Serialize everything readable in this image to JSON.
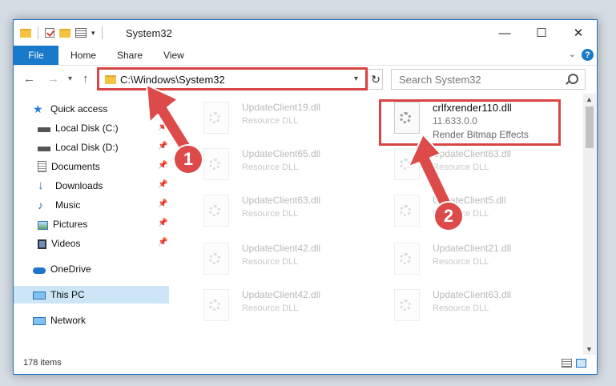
{
  "window": {
    "title": "System32",
    "minimize": "—",
    "maximize": "☐",
    "close": "✕"
  },
  "ribbon": {
    "tabs": [
      {
        "label": "File"
      },
      {
        "label": "Home"
      },
      {
        "label": "Share"
      },
      {
        "label": "View"
      }
    ],
    "help": "?"
  },
  "address": {
    "path": "C:\\Windows\\System32",
    "search_placeholder": "Search System32"
  },
  "sidebar": {
    "items": [
      {
        "label": "Quick access",
        "icon": "star-icon",
        "pinned": false
      },
      {
        "label": "Local Disk (C:)",
        "icon": "drive-icon",
        "pinned": true
      },
      {
        "label": "Local Disk (D:)",
        "icon": "drive-icon",
        "pinned": true
      },
      {
        "label": "Documents",
        "icon": "documents-icon",
        "pinned": true
      },
      {
        "label": "Downloads",
        "icon": "download-icon",
        "pinned": true
      },
      {
        "label": "Music",
        "icon": "music-icon",
        "pinned": true
      },
      {
        "label": "Pictures",
        "icon": "pictures-icon",
        "pinned": true
      },
      {
        "label": "Videos",
        "icon": "videos-icon",
        "pinned": true
      },
      {
        "label": "OneDrive",
        "icon": "cloud-icon",
        "pinned": false
      },
      {
        "label": "This PC",
        "icon": "computer-icon",
        "pinned": false,
        "selected": true
      },
      {
        "label": "Network",
        "icon": "network-icon",
        "pinned": false
      }
    ]
  },
  "files": {
    "left": [
      {
        "name": "UpdateClient19.dll",
        "type": "Resource DLL"
      },
      {
        "name": "UpdateClient65.dll",
        "type": "Resource DLL"
      },
      {
        "name": "UpdateClient63.dll",
        "type": "Resource DLL"
      },
      {
        "name": "UpdateClient42.dll",
        "type": "Resource DLL"
      },
      {
        "name": "UpdateClient42.dll",
        "type": "Resource DLL"
      }
    ],
    "right": [
      {
        "name": "crlfxrender110.dll",
        "version": "11.633.0.0",
        "type": "Render Bitmap Effects",
        "highlighted": true
      },
      {
        "name": "UpdateClient63.dll",
        "type": "Resource DLL"
      },
      {
        "name": "UpdateClient5.dll",
        "type": "Resource DLL"
      },
      {
        "name": "UpdateClient21.dll",
        "type": "Resource DLL"
      },
      {
        "name": "UpdateClient63.dll",
        "type": "Resource DLL"
      }
    ]
  },
  "status": {
    "item_count": "178 items"
  },
  "annotations": {
    "step1": "1",
    "step2": "2",
    "color": "#dd4a4a"
  }
}
